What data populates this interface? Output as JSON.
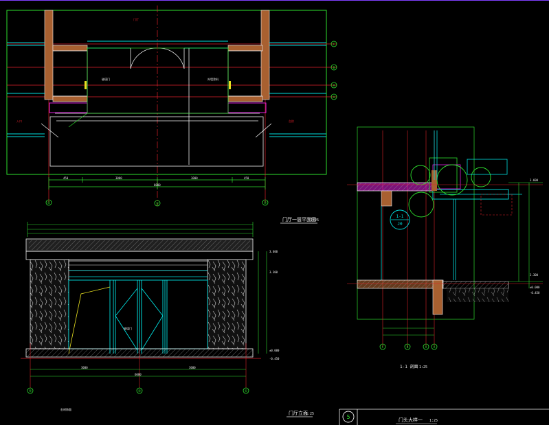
{
  "drawing": {
    "plan": {
      "title": "门厅一层平面图",
      "scale": "1:25",
      "axes": [
        "①",
        "③",
        "⑤"
      ],
      "row_axes": [
        "C",
        "B",
        "A",
        "A"
      ],
      "dims": [
        "450",
        "3000",
        "3000",
        "450",
        "6000"
      ],
      "notes": [
        "门厅",
        "玻璃门",
        "外墙涂料",
        "入口",
        "台阶"
      ]
    },
    "elevation": {
      "title": "门厅立面",
      "scale": "1:25",
      "axes": [
        "⑤",
        "③",
        "①"
      ],
      "dims": [
        "6000",
        "3000",
        "3000"
      ],
      "levels": [
        "3.600",
        "3.300",
        "±0.000",
        "-0.450"
      ],
      "notes": [
        "玻璃门",
        "石材饰面"
      ]
    },
    "section": {
      "title": "1-1 剖面",
      "scale": "1:25",
      "callout": "1-1",
      "callout_sub": "J0",
      "axes": [
        "C",
        "B",
        "A",
        "A"
      ],
      "levels": [
        "3.600",
        "3.300",
        "±0.000",
        "-0.450"
      ]
    },
    "title_block": {
      "sheet_no": "5",
      "label": "门头大样一",
      "scale": "1:25"
    }
  },
  "colors": {
    "background": "#000000",
    "axis_red": "#e0202a",
    "green": "#2ee02e",
    "cyan": "#00e0e0",
    "white": "#f0f0f0",
    "yellow": "#e8e020",
    "magenta": "#e020e0",
    "brown": "#a86030",
    "purple_line": "#8040ff"
  }
}
